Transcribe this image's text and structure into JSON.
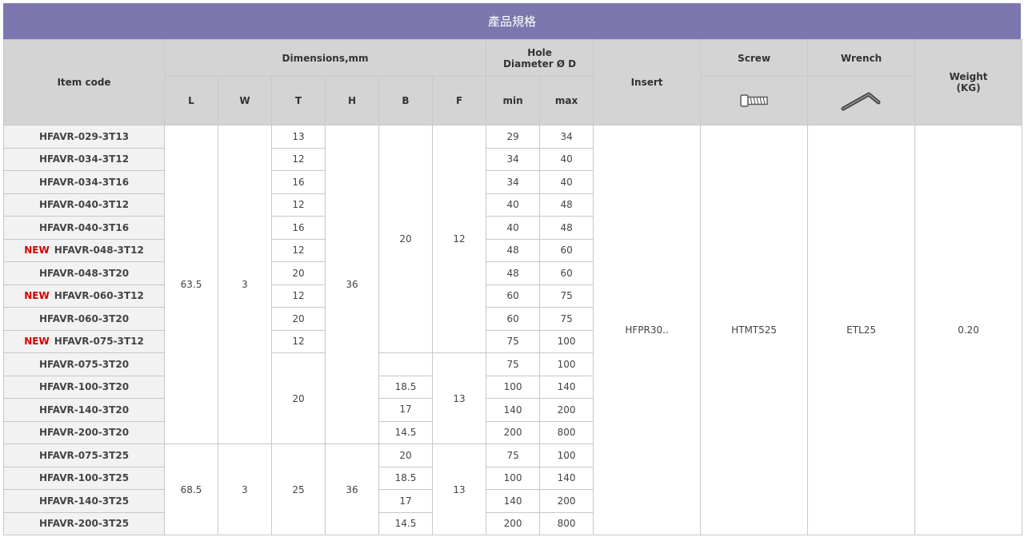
{
  "title": "產品規格",
  "headers": {
    "item_code": "Item code",
    "dimensions": "Dimensions,mm",
    "hole_line1": "Hole",
    "hole_line2": "Diameter Ø D",
    "insert": "Insert",
    "screw": "Screw",
    "wrench": "Wrench",
    "weight_line1": "Weight",
    "weight_line2": "(KG)",
    "L": "L",
    "W": "W",
    "T": "T",
    "H": "H",
    "B": "B",
    "F": "F",
    "min": "min",
    "max": "max",
    "screw_icon": "screw-icon",
    "wrench_icon": "hex-wrench-icon"
  },
  "new_label": "NEW",
  "rows": [
    {
      "code": "HFAVR-029-3T13",
      "new": false,
      "T": "13",
      "min": "29",
      "max": "34"
    },
    {
      "code": "HFAVR-034-3T12",
      "new": false,
      "T": "12",
      "min": "34",
      "max": "40"
    },
    {
      "code": "HFAVR-034-3T16",
      "new": false,
      "T": "16",
      "min": "34",
      "max": "40"
    },
    {
      "code": "HFAVR-040-3T12",
      "new": false,
      "T": "12",
      "min": "40",
      "max": "48"
    },
    {
      "code": "HFAVR-040-3T16",
      "new": false,
      "T": "16",
      "min": "40",
      "max": "48"
    },
    {
      "code": "HFAVR-048-3T12",
      "new": true,
      "T": "12",
      "min": "48",
      "max": "60"
    },
    {
      "code": "HFAVR-048-3T20",
      "new": false,
      "T": "20",
      "min": "48",
      "max": "60"
    },
    {
      "code": "HFAVR-060-3T12",
      "new": true,
      "T": "12",
      "min": "60",
      "max": "75"
    },
    {
      "code": "HFAVR-060-3T20",
      "new": false,
      "T": "20",
      "min": "60",
      "max": "75"
    },
    {
      "code": "HFAVR-075-3T12",
      "new": true,
      "T": "12",
      "min": "75",
      "max": "100"
    },
    {
      "code": "HFAVR-075-3T20",
      "new": false,
      "min": "75",
      "max": "100"
    },
    {
      "code": "HFAVR-100-3T20",
      "new": false,
      "B": "18.5",
      "min": "100",
      "max": "140"
    },
    {
      "code": "HFAVR-140-3T20",
      "new": false,
      "B": "17",
      "min": "140",
      "max": "200"
    },
    {
      "code": "HFAVR-200-3T20",
      "new": false,
      "B": "14.5",
      "min": "200",
      "max": "800"
    },
    {
      "code": "HFAVR-075-3T25",
      "new": false,
      "B": "20",
      "min": "75",
      "max": "100"
    },
    {
      "code": "HFAVR-100-3T25",
      "new": false,
      "B": "18.5",
      "min": "100",
      "max": "140"
    },
    {
      "code": "HFAVR-140-3T25",
      "new": false,
      "B": "17",
      "min": "140",
      "max": "200"
    },
    {
      "code": "HFAVR-200-3T25",
      "new": false,
      "B": "14.5",
      "min": "200",
      "max": "800"
    }
  ],
  "groups": {
    "g1": {
      "L": "63.5",
      "W": "3",
      "H": "36",
      "B_top": "20",
      "F_top": "12",
      "T_bottom": "20",
      "F_bottom": "13"
    },
    "g2": {
      "L": "68.5",
      "W": "3",
      "T": "25",
      "H": "36",
      "F": "13"
    }
  },
  "shared": {
    "insert": "HFPR30..",
    "screw": "HTMT525",
    "wrench": "ETL25",
    "weight": "0.20"
  },
  "colors": {
    "header_bar": "#7d77b0",
    "header_cell": "#d4d4d4",
    "new_label": "#d40000"
  }
}
